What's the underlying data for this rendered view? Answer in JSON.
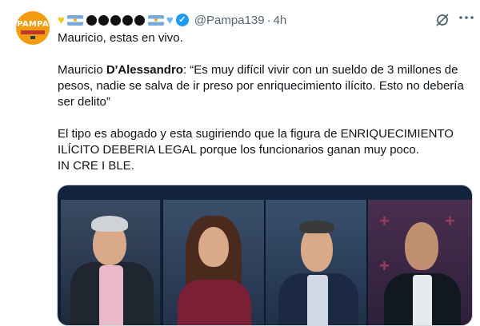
{
  "avatar": {
    "logo_text": "PAMPA"
  },
  "header": {
    "handle": "@Pampa139",
    "separator": "·",
    "time": "4h"
  },
  "tweet": {
    "line1": "Mauricio, estas en vivo.",
    "para2_prefix": "Mauricio ",
    "para2_name": "D'Alessandro",
    "para2_rest": ": “Es muy difícil vivir con un sueldo de 3 millones de pesos, nadie se salva de ir preso por enriquecimiento ilícito. Esto no debería ser delito”",
    "para3": "El tipo es abogado y esta sugiriendo que la figura de ENRIQUECIMIENTO ILÍCITO DEBERIA LEGAL porque los funcionarios ganan muy poco.",
    "para4": "IN CRE I BLE."
  },
  "icons": {
    "grok": "grok-icon",
    "more": "more-icon",
    "verified": "verified-badge-icon"
  },
  "colors": {
    "accent": "#1d9bf0",
    "muted": "#536471",
    "text": "#0f1419"
  }
}
